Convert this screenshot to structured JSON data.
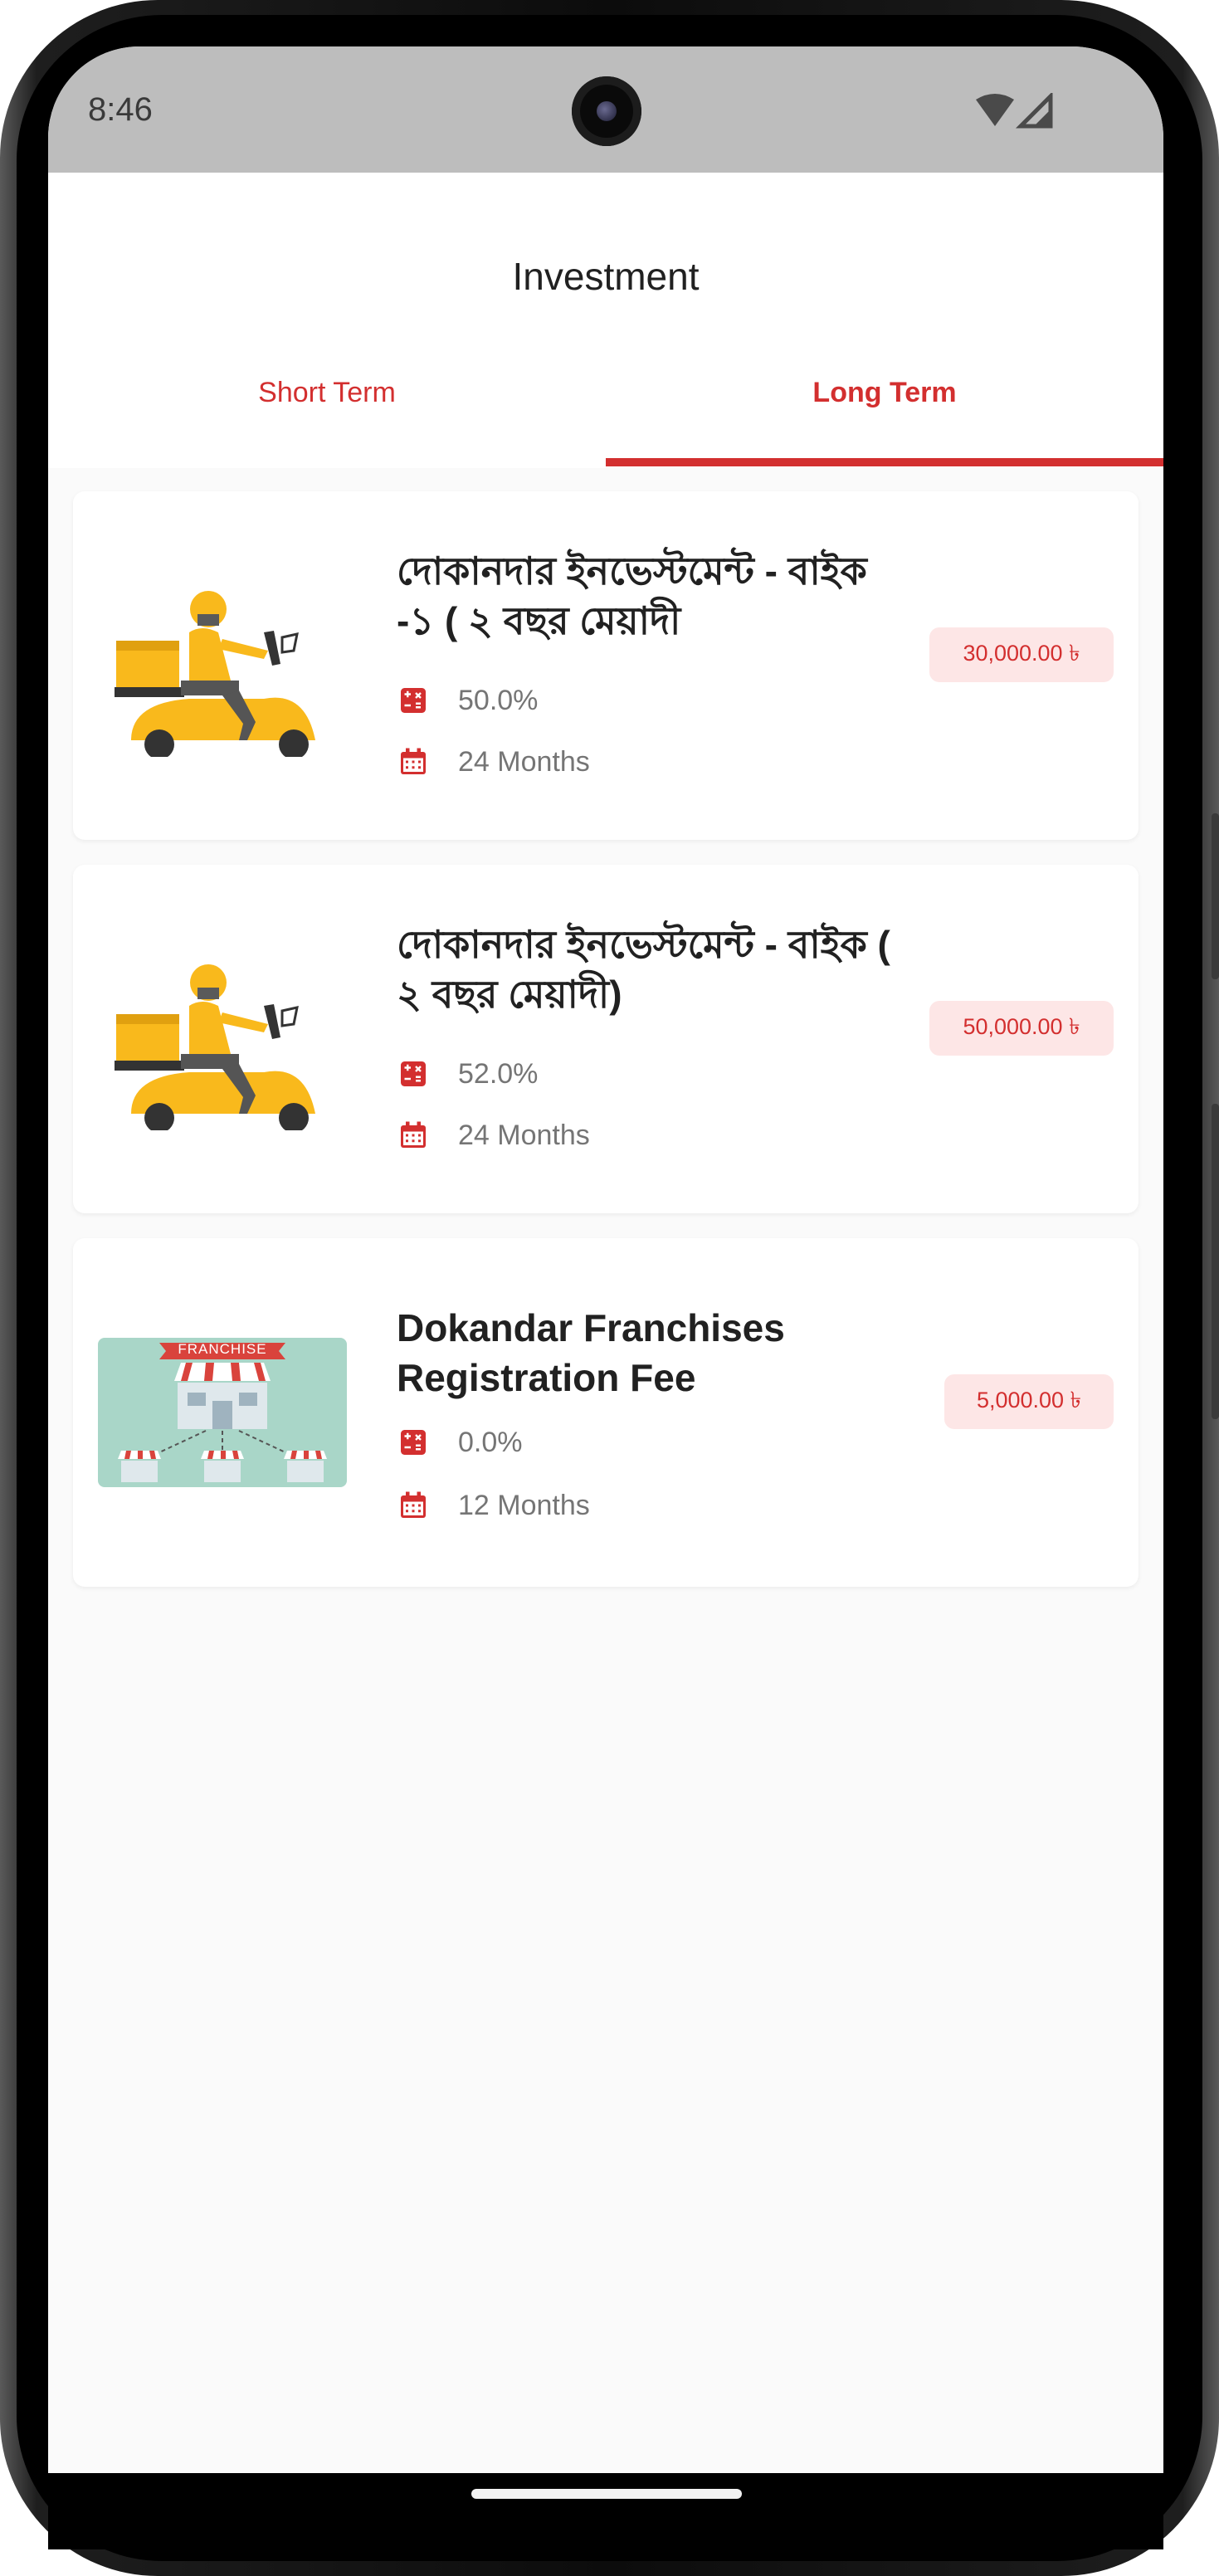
{
  "status": {
    "time": "8:46"
  },
  "header": {
    "title": "Investment"
  },
  "tabs": [
    {
      "label": "Short Term",
      "active": false
    },
    {
      "label": "Long Term",
      "active": true
    }
  ],
  "colors": {
    "accent": "#d32f2f",
    "price_bg": "#fde6e6",
    "scooter": "#f9b91c"
  },
  "items": [
    {
      "title": "দোকানদার ইনভেস্টমেন্ট - বাইক -১  ( ২ বছর মেয়াদী",
      "rate": "50.0%",
      "duration": "24 Months",
      "price": "30,000.00 ৳",
      "image": "delivery-scooter"
    },
    {
      "title": "দোকানদার ইনভেস্টমেন্ট - বাইক ( ২ বছর মেয়াদী)",
      "rate": "52.0%",
      "duration": "24 Months",
      "price": "50,000.00 ৳",
      "image": "delivery-scooter"
    },
    {
      "title": "Dokandar Franchises Registration Fee",
      "rate": "0.0%",
      "duration": "12 Months",
      "price": "5,000.00 ৳",
      "image": "franchise",
      "image_label": "FRANCHISE"
    }
  ]
}
